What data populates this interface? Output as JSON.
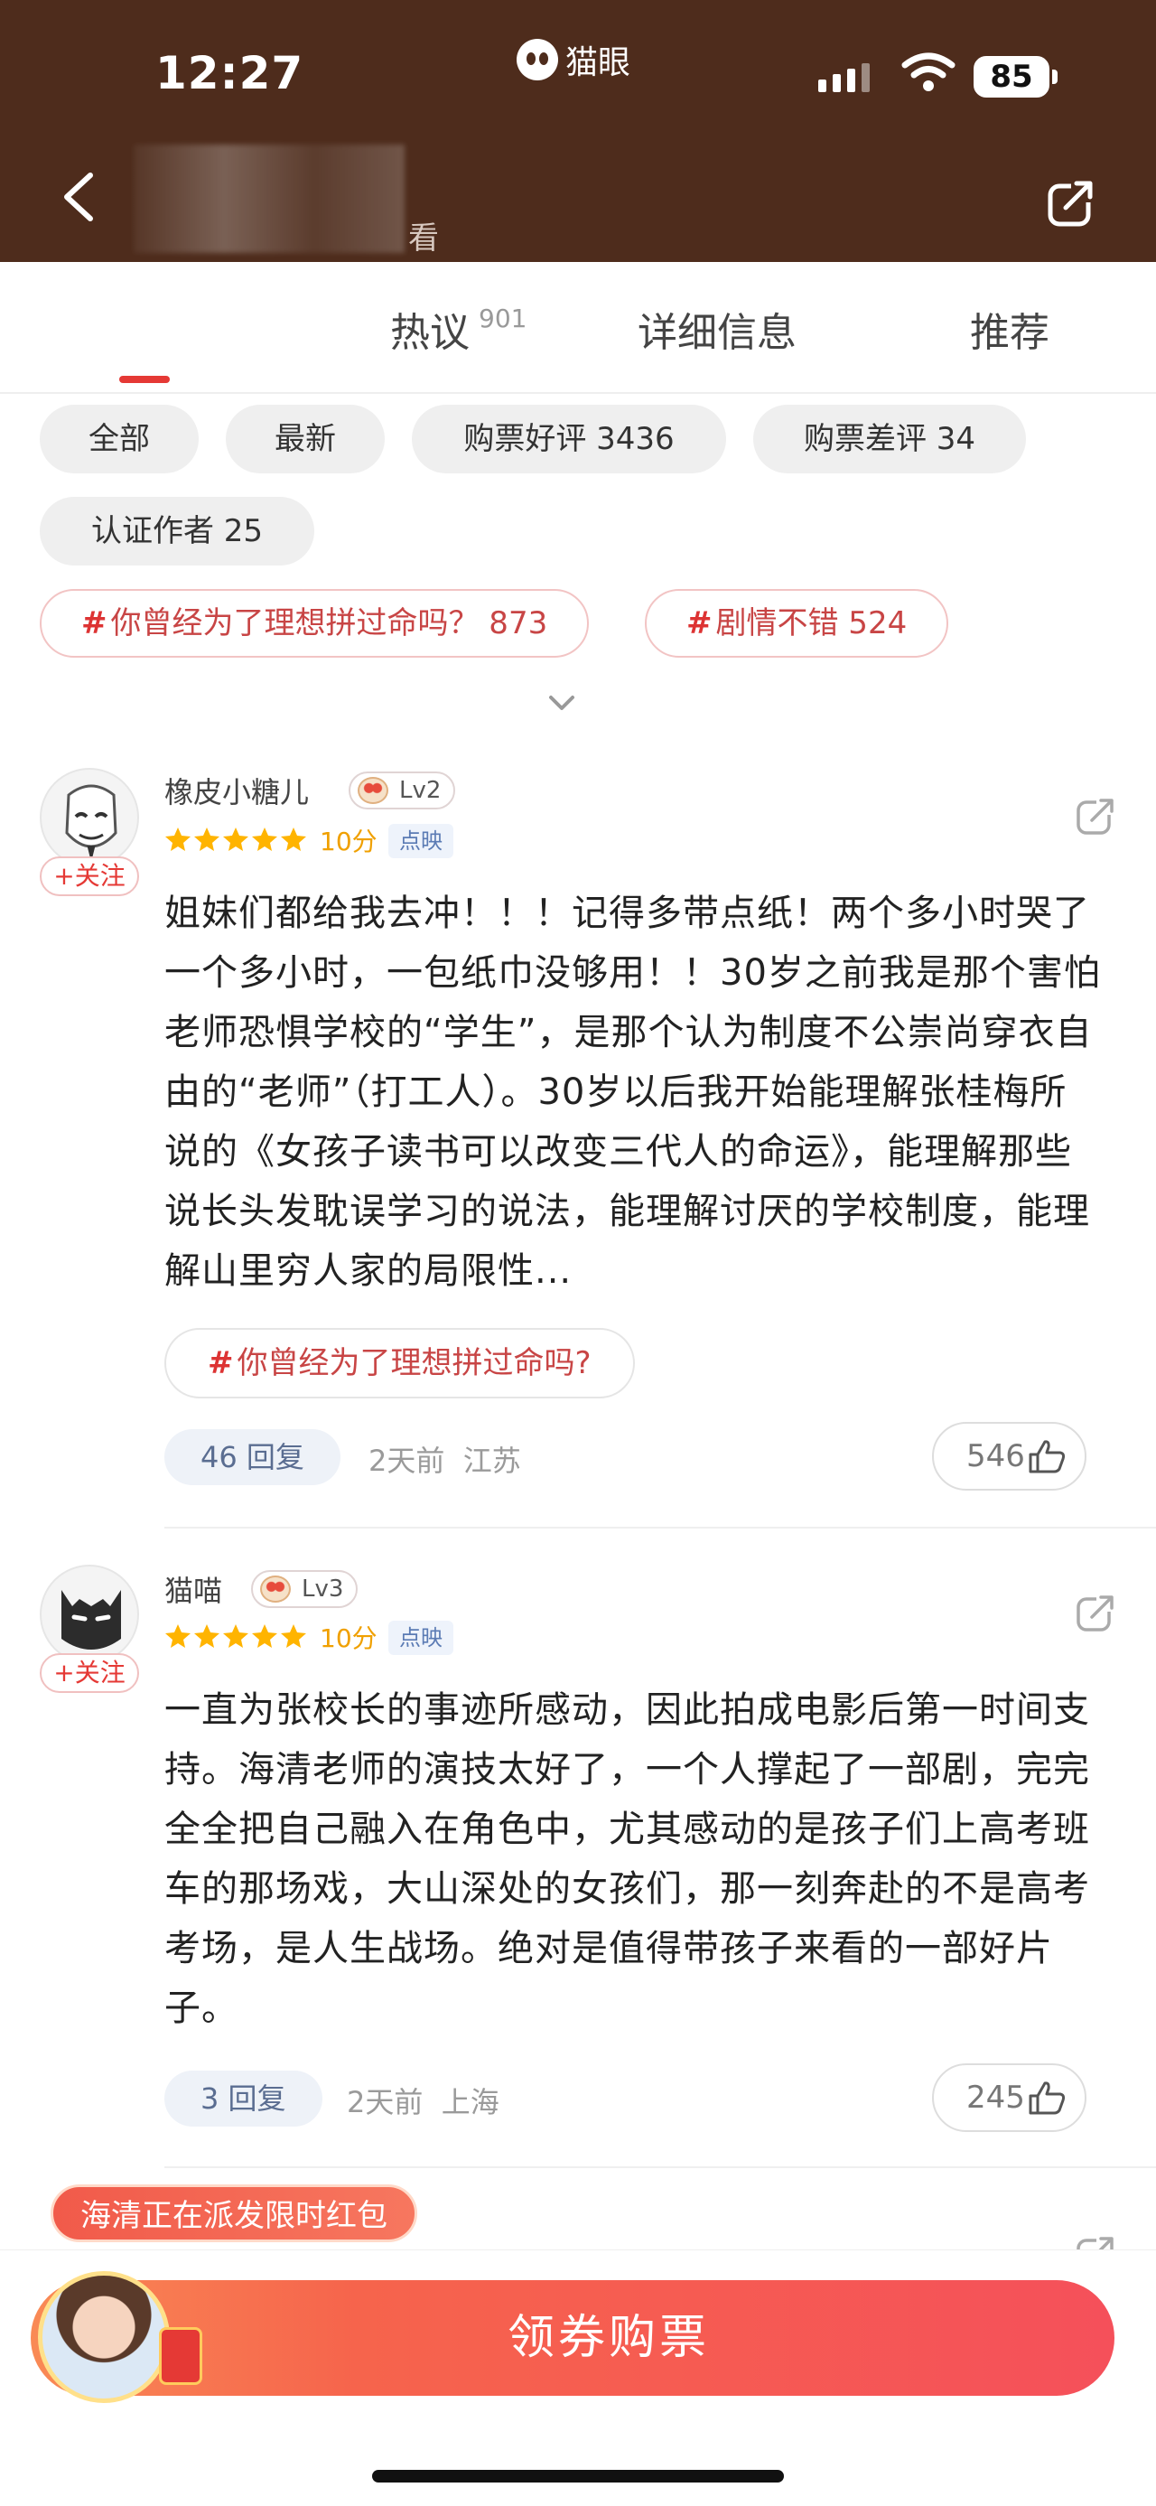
{
  "status_bar": {
    "time": "12:27",
    "app_name": "猫眼",
    "battery": "85"
  },
  "header": {
    "title_suffix": "看"
  },
  "tabs": [
    {
      "label": "热议",
      "count": "901"
    },
    {
      "label": "详细信息"
    },
    {
      "label": "推荐"
    }
  ],
  "filters": [
    {
      "label": "全部"
    },
    {
      "label": "最新"
    },
    {
      "label": "购票好评 3436"
    },
    {
      "label": "购票差评 34"
    },
    {
      "label": "认证作者 25"
    }
  ],
  "topics": [
    {
      "hash": "#",
      "label": "你曾经为了理想拼过命吗？  873"
    },
    {
      "hash": "#",
      "label": "剧情不错 524"
    }
  ],
  "comments": [
    {
      "username": "橡皮小糖儿",
      "level": "Lv2",
      "score": "10分",
      "source": "点映",
      "follow": "+关注",
      "text": "姐妹们都给我去冲！！！记得多带点纸！两个多小时哭了一个多小时，一包纸巾没够用！！30岁之前我是那个害怕老师恐惧学校的“学生”，是那个认为制度不公崇尚穿衣自由的“老师”（打工人）。30岁以后我开始能理解张桂梅所说的《女孩子读书可以改变三代人的命运》，能理解那些说长头发耽误学习的说法，能理解讨厌的学校制度，能理解山里穷人家的局限性...",
      "topic_hash": "#",
      "topic": "你曾经为了理想拼过命吗?",
      "replies": "46 回复",
      "time": "2天前",
      "location": "江苏",
      "likes": "546"
    },
    {
      "username": "猫喵",
      "level": "Lv3",
      "score": "10分",
      "source": "点映",
      "follow": "+关注",
      "text": "一直为张校长的事迹所感动，因此拍成电影后第一时间支持。海清老师的演技太好了，一个人撑起了一部剧，完完全全把自己融入在角色中，尤其感动的是孩子们上高考班车的那场戏，大山深处的女孩们，那一刻奔赴的不是高考考场，是人生战场。绝对是值得带孩子来看的一部好片子。",
      "replies": "3 回复",
      "time": "2天前",
      "location": "上海",
      "likes": "245"
    }
  ],
  "promo": {
    "bubble": "海清正在派发限时红包",
    "button": "领券购票"
  }
}
